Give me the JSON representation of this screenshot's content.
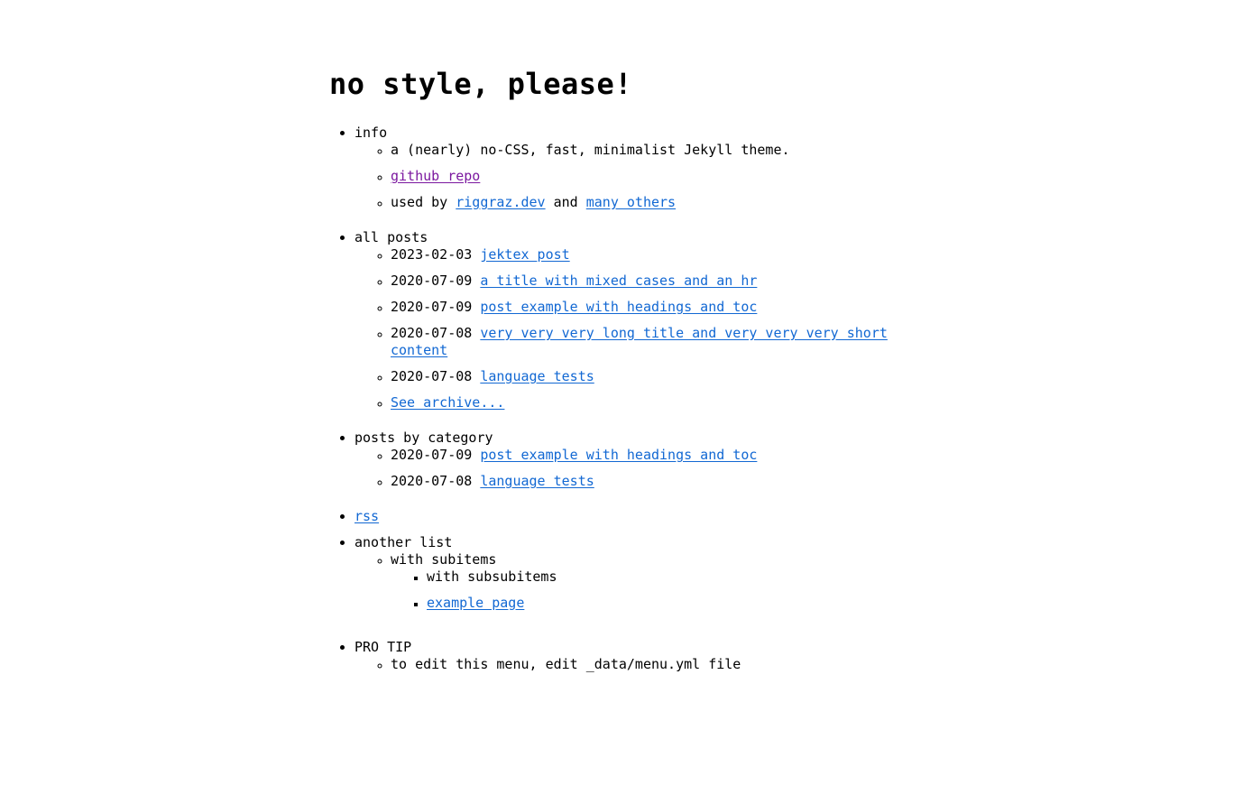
{
  "site": {
    "title": "no style, please!"
  },
  "colors": {
    "link": "#1268d3",
    "visited_link": "#7b189f",
    "text": "#000000",
    "background": "#ffffff"
  },
  "menu": {
    "sections": [
      {
        "label": "info",
        "is_link": false,
        "children": [
          {
            "text": "a (nearly) no-CSS, fast, minimalist Jekyll theme.",
            "is_link": false
          },
          {
            "text": "github repo",
            "is_link": true,
            "visited": true
          },
          {
            "is_link": false,
            "parts": [
              {
                "text": "used by ",
                "is_link": false
              },
              {
                "text": "riggraz.dev",
                "is_link": true
              },
              {
                "text": " and ",
                "is_link": false
              },
              {
                "text": "many others",
                "is_link": true
              }
            ]
          }
        ]
      },
      {
        "label": "all posts",
        "is_link": false,
        "children": [
          {
            "date": "2023-02-03",
            "text": "jektex post",
            "is_link": true
          },
          {
            "date": "2020-07-09",
            "text": "a title with mixed cases and an hr",
            "is_link": true
          },
          {
            "date": "2020-07-09",
            "text": "post example with headings and toc",
            "is_link": true
          },
          {
            "date": "2020-07-08",
            "text": "very very very long title and very very very short content",
            "is_link": true
          },
          {
            "date": "2020-07-08",
            "text": "language tests",
            "is_link": true
          },
          {
            "text": "See archive...",
            "is_link": true
          }
        ]
      },
      {
        "label": "posts by category",
        "is_link": false,
        "children": [
          {
            "date": "2020-07-09",
            "text": "post example with headings and toc",
            "is_link": true
          },
          {
            "date": "2020-07-08",
            "text": "language tests",
            "is_link": true
          }
        ]
      },
      {
        "label": "rss",
        "is_link": true,
        "children": []
      },
      {
        "label": "another list",
        "is_link": false,
        "children": [
          {
            "text": "with subitems",
            "is_link": false,
            "children": [
              {
                "text": "with subsubitems",
                "is_link": false
              },
              {
                "text": "example page",
                "is_link": true
              }
            ]
          }
        ]
      },
      {
        "label": "PRO TIP",
        "is_link": false,
        "children": [
          {
            "text": "to edit this menu, edit _data/menu.yml file",
            "is_link": false
          }
        ]
      }
    ]
  }
}
